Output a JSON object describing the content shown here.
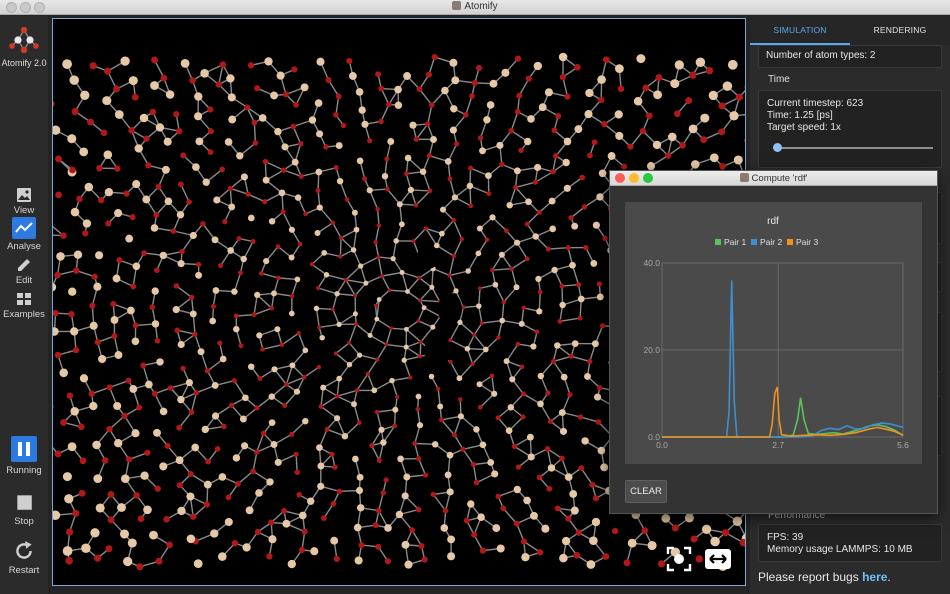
{
  "window": {
    "title": "Atomify"
  },
  "sidebar": {
    "app_name": "Atomify 2.0",
    "tools": [
      {
        "label": "View"
      },
      {
        "label": "Analyse"
      },
      {
        "label": "Edit"
      },
      {
        "label": "Examples"
      }
    ],
    "running_label": "Running",
    "stop_label": "Stop",
    "restart_label": "Restart"
  },
  "right_panel": {
    "tabs": [
      {
        "label": "SIMULATION",
        "active": true
      },
      {
        "label": "RENDERING",
        "active": false
      }
    ],
    "atom_types": "Number of atom types: 2",
    "time_heading": "Time",
    "current_timestep": "Current timestep: 623",
    "time": "Time: 1.25 [ps]",
    "target_speed": "Target speed: 1x",
    "speed_slider_value": 0,
    "performance_heading": "Performance",
    "fps": "FPS: 39",
    "memory": "Memory usage LAMMPS: 10 MB",
    "report_text": "Please report bugs ",
    "report_link": "here",
    "report_end": "."
  },
  "dialog": {
    "title": "Compute 'rdf'",
    "clear_label": "CLEAR"
  },
  "colors": {
    "accent": "#2d7be0",
    "pair1": "#5cc25c",
    "pair2": "#3d8fd1",
    "pair3": "#f0921e",
    "oxygen_atom": "#b31818",
    "silicon_atom": "#e6c8a6"
  },
  "chart_data": {
    "type": "line",
    "title": "rdf",
    "xlabel": "",
    "ylabel": "",
    "xlim": [
      0,
      5.6
    ],
    "ylim": [
      0,
      40
    ],
    "x_ticks": [
      "0.0",
      "2.7",
      "5.6"
    ],
    "y_ticks": [
      "0.0",
      "20.0",
      "40.0"
    ],
    "legend_position": "top",
    "grid": true,
    "series": [
      {
        "name": "Pair 1",
        "color": "#5cc25c",
        "points": [
          [
            0,
            0
          ],
          [
            2.9,
            0
          ],
          [
            3.05,
            0.5
          ],
          [
            3.15,
            4
          ],
          [
            3.22,
            9
          ],
          [
            3.3,
            4
          ],
          [
            3.4,
            0.8
          ],
          [
            3.6,
            0.6
          ],
          [
            3.8,
            0.8
          ],
          [
            4.0,
            1.0
          ],
          [
            4.2,
            0.7
          ],
          [
            4.4,
            1.2
          ],
          [
            4.6,
            1.8
          ],
          [
            4.8,
            2.5
          ],
          [
            5.0,
            2.8
          ],
          [
            5.2,
            2.4
          ],
          [
            5.4,
            1.6
          ],
          [
            5.6,
            0.4
          ]
        ]
      },
      {
        "name": "Pair 2",
        "color": "#3d8fd1",
        "points": [
          [
            0,
            0
          ],
          [
            1.5,
            0
          ],
          [
            1.56,
            6
          ],
          [
            1.62,
            36
          ],
          [
            1.68,
            8
          ],
          [
            1.74,
            0
          ],
          [
            3.2,
            0
          ],
          [
            3.5,
            0.3
          ],
          [
            3.7,
            1.5
          ],
          [
            3.9,
            2.0
          ],
          [
            4.1,
            1.7
          ],
          [
            4.3,
            2.6
          ],
          [
            4.5,
            1.8
          ],
          [
            4.7,
            2.0
          ],
          [
            4.9,
            2.8
          ],
          [
            5.1,
            3.2
          ],
          [
            5.3,
            3.0
          ],
          [
            5.6,
            2.2
          ]
        ]
      },
      {
        "name": "Pair 3",
        "color": "#f0921e",
        "points": [
          [
            0,
            0
          ],
          [
            2.5,
            0
          ],
          [
            2.56,
            3
          ],
          [
            2.62,
            10
          ],
          [
            2.68,
            11.5
          ],
          [
            2.72,
            4
          ],
          [
            2.78,
            0.5
          ],
          [
            3.0,
            0.2
          ],
          [
            3.3,
            0.4
          ],
          [
            3.6,
            0.5
          ],
          [
            3.9,
            0.4
          ],
          [
            4.2,
            0.6
          ],
          [
            4.5,
            1.0
          ],
          [
            4.8,
            1.8
          ],
          [
            5.0,
            2.2
          ],
          [
            5.2,
            1.8
          ],
          [
            5.4,
            1.3
          ],
          [
            5.6,
            0.4
          ]
        ]
      }
    ]
  }
}
